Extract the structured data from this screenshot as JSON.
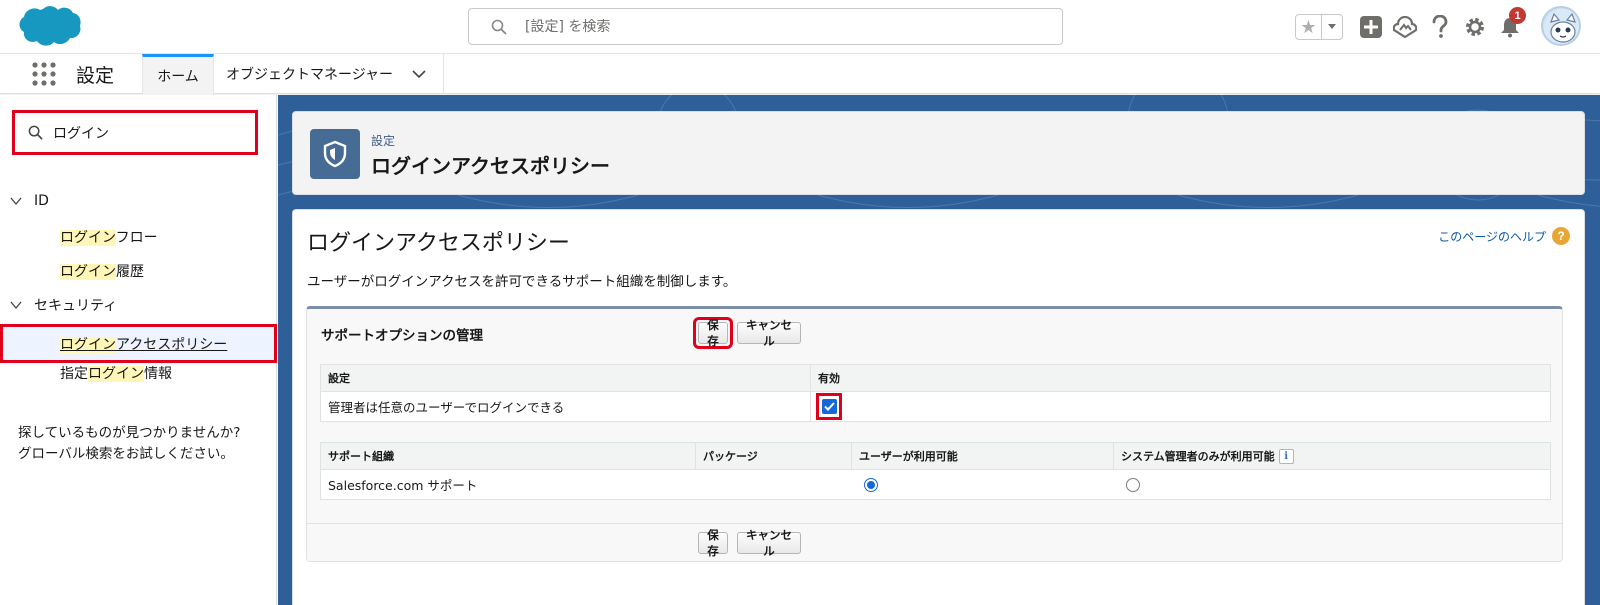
{
  "header": {
    "search_placeholder": "[設定] を検索",
    "notification_count": "1"
  },
  "nav": {
    "app_name": "設定",
    "tabs": [
      {
        "label": "ホーム",
        "active": true
      },
      {
        "label": "オブジェクトマネージャー",
        "active": false
      }
    ]
  },
  "sidebar": {
    "quickfind_value": "ログイン",
    "groups": [
      {
        "label": "ID",
        "items": [
          {
            "highlight": "ログイン",
            "rest": "フロー"
          },
          {
            "highlight": "ログイン",
            "rest": "履歴"
          }
        ]
      },
      {
        "label": "セキュリティ",
        "items": [
          {
            "highlight": "ログイン",
            "rest": "アクセスポリシー",
            "selected": true
          },
          {
            "prefix": "指定",
            "highlight": "ログイン",
            "rest": "情報"
          }
        ]
      }
    ],
    "not_found_line1": "探しているものが見つかりませんか?",
    "not_found_line2": "グローバル検索をお試しください。"
  },
  "page_header": {
    "kicker": "設定",
    "title": "ログインアクセスポリシー"
  },
  "content": {
    "title": "ログインアクセスポリシー",
    "help_link": "このページのヘルプ",
    "description": "ユーザーがログインアクセスを許可できるサポート組織を制御します。",
    "block": {
      "title": "サポートオプションの管理",
      "save_label": "保存",
      "cancel_label": "キャンセル",
      "settings_table": {
        "headers": [
          "設定",
          "有効"
        ],
        "rows": [
          {
            "setting": "管理者は任意のユーザーでログインできる",
            "enabled": true
          }
        ]
      },
      "support_table": {
        "headers": [
          "サポート組織",
          "パッケージ",
          "ユーザーが利用可能",
          "システム管理者のみが利用可能"
        ],
        "rows": [
          {
            "org": "Salesforce.com サポート",
            "package": "",
            "user_available": true,
            "admin_only": false
          }
        ]
      }
    }
  },
  "colors": {
    "accent": "#1b96ff",
    "highlight_box": "#e0001b",
    "main_bg": "#2f5f98",
    "checkbox": "#1668d6"
  }
}
